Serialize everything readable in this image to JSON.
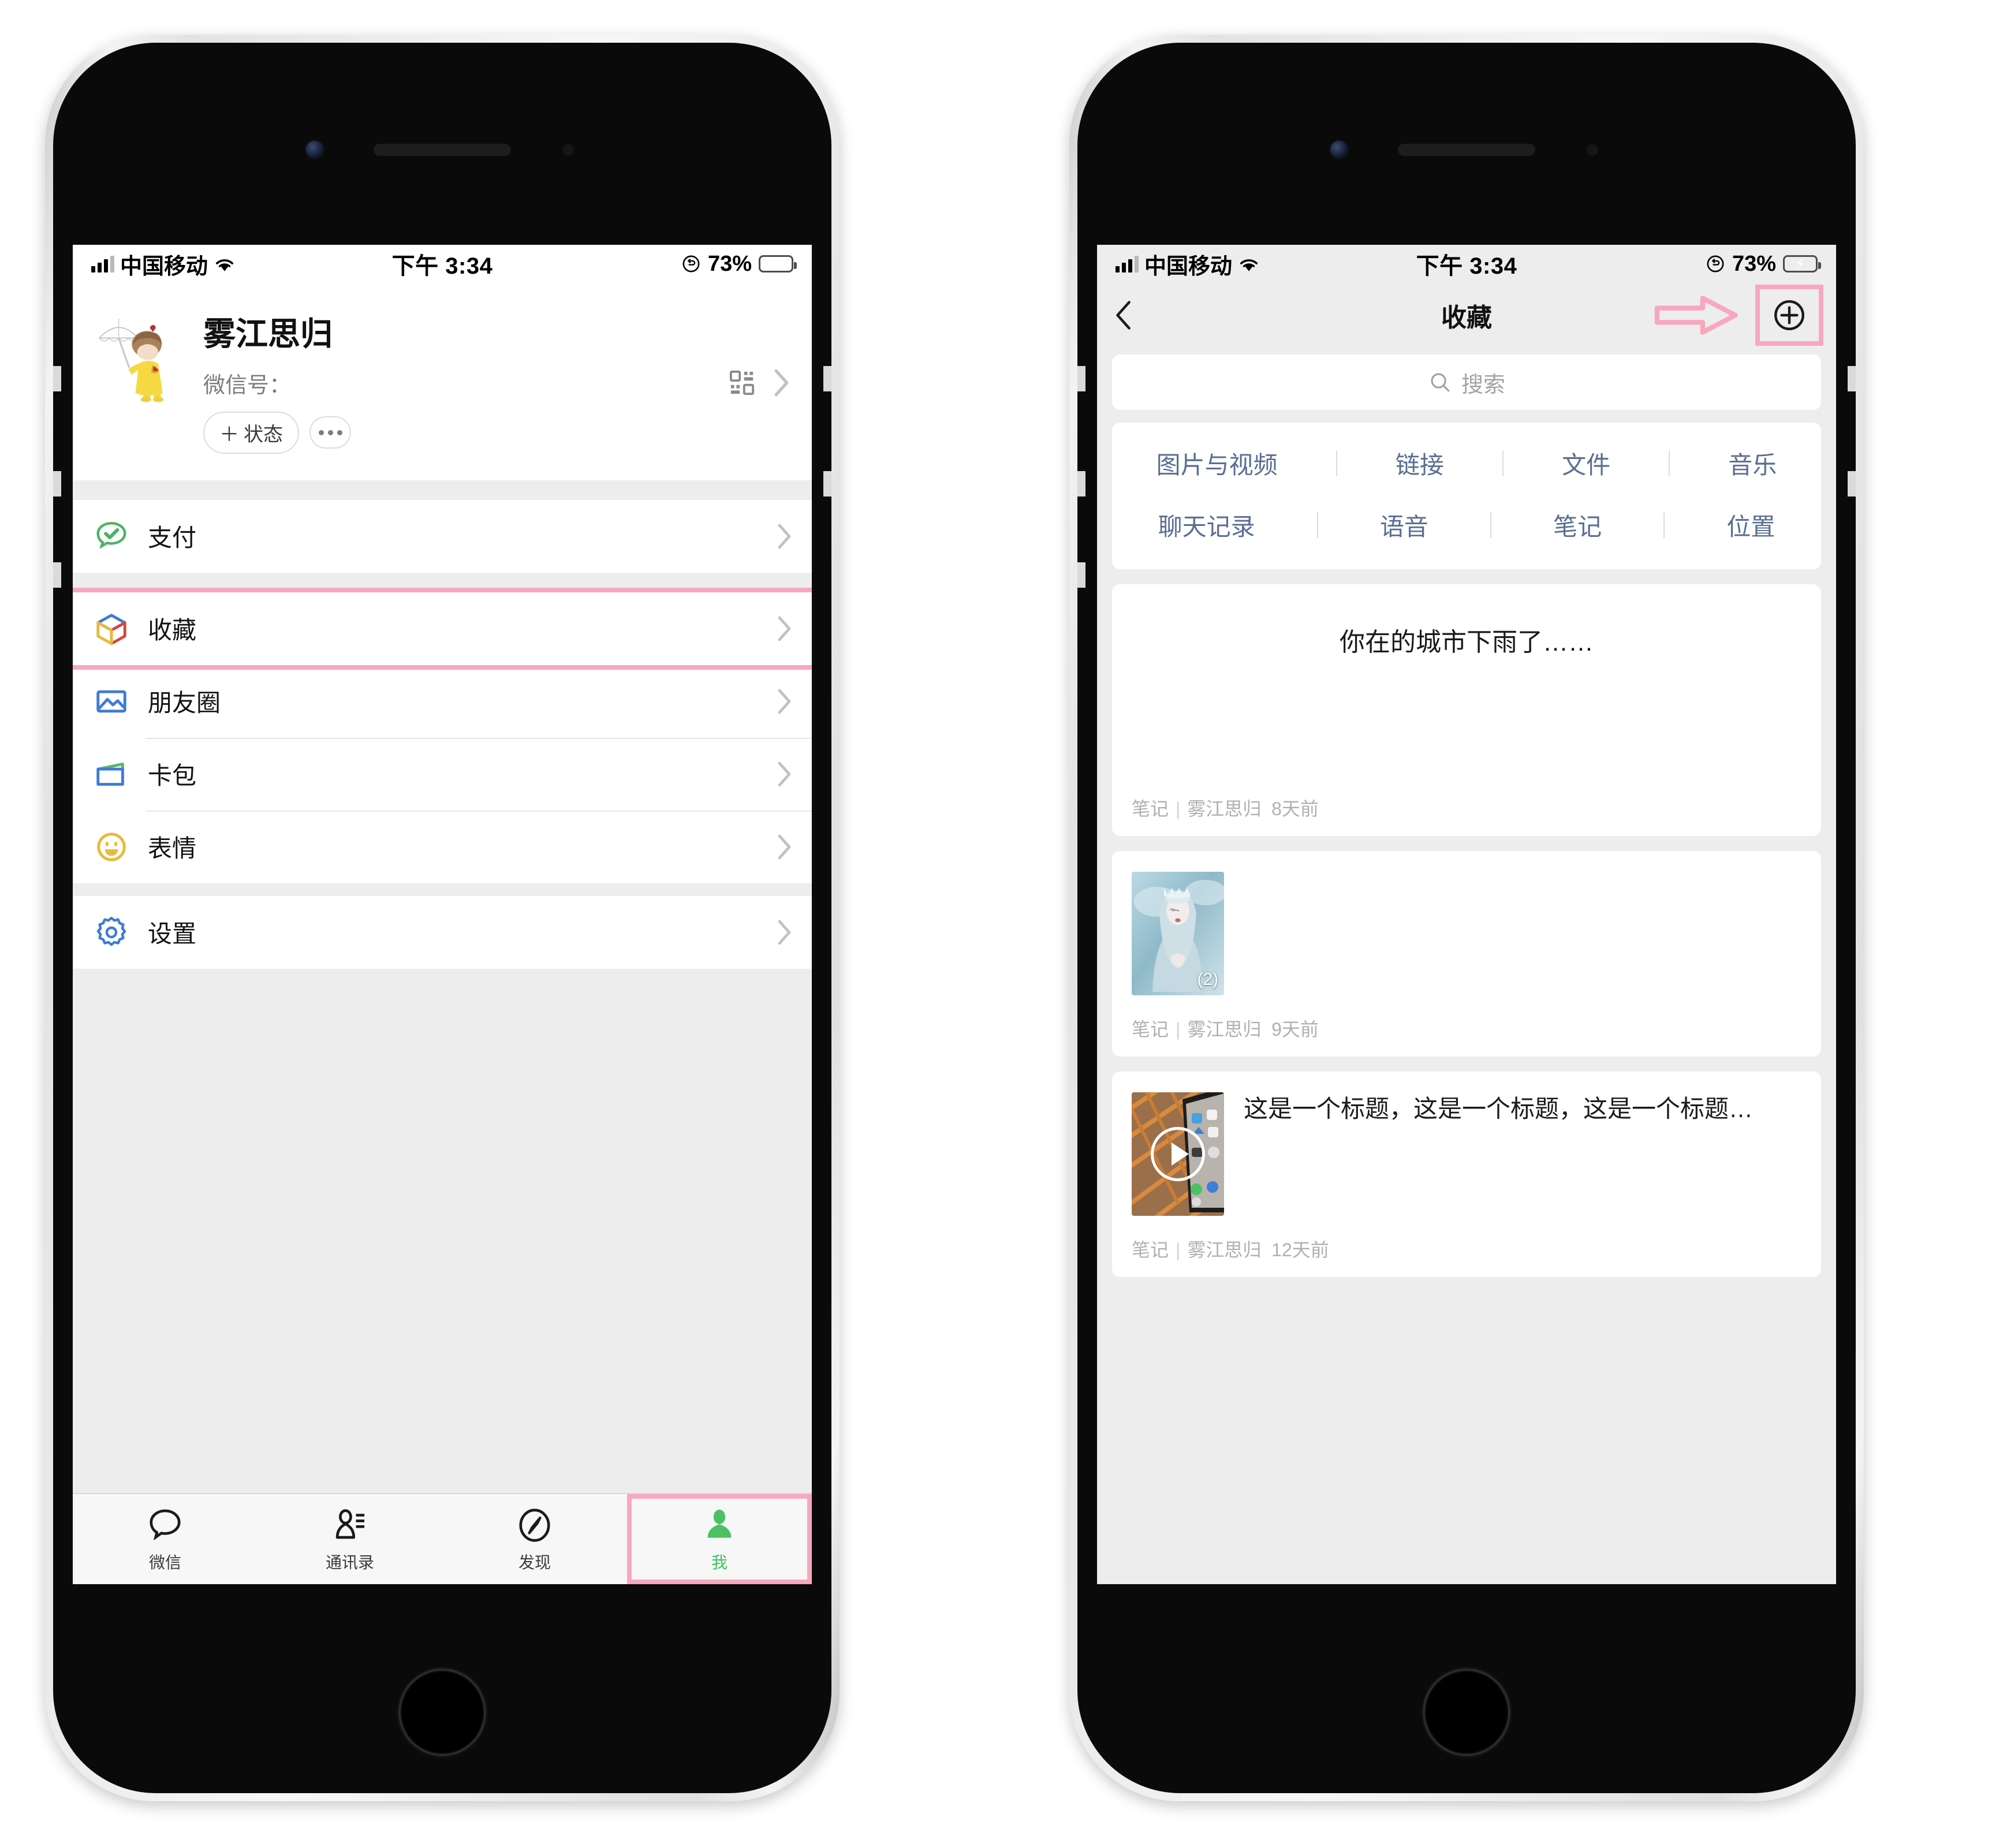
{
  "status_bar": {
    "carrier": "中国移动",
    "time": "下午 3:34",
    "battery_percent": "73%",
    "wifi_icon": "wifi-icon",
    "signal_icon": "signal-bars-icon",
    "rotation_lock_icon": "rotation-lock-icon",
    "battery_icon": "battery-charging-icon"
  },
  "left_phone": {
    "profile": {
      "avatar_icon": "avatar-girl-umbrella",
      "name": "雾江思归",
      "wechat_id_label": "微信号：",
      "qr_icon": "qr-code-icon",
      "chevron_icon": "chevron-right-icon",
      "status_button": "状态",
      "status_plus": "＋",
      "more_button_icon": "more-dots-icon"
    },
    "menu_groups": [
      {
        "items": [
          {
            "label": "支付",
            "icon": "pay-check-bubble-icon",
            "highlighted": false
          }
        ]
      },
      {
        "items": [
          {
            "label": "收藏",
            "icon": "favorites-cube-icon",
            "highlighted": true
          },
          {
            "label": "朋友圈",
            "icon": "moments-photo-icon",
            "highlighted": false
          },
          {
            "label": "卡包",
            "icon": "cards-wallet-icon",
            "highlighted": false
          },
          {
            "label": "表情",
            "icon": "stickers-smiley-icon",
            "highlighted": false
          }
        ]
      },
      {
        "items": [
          {
            "label": "设置",
            "icon": "settings-gear-icon",
            "highlighted": false
          }
        ]
      }
    ],
    "tabbar": [
      {
        "label": "微信",
        "icon": "chat-bubble-icon",
        "active": false,
        "highlighted": false
      },
      {
        "label": "通讯录",
        "icon": "contacts-icon",
        "active": false,
        "highlighted": false
      },
      {
        "label": "发现",
        "icon": "compass-icon",
        "active": false,
        "highlighted": false
      },
      {
        "label": "我",
        "icon": "person-icon",
        "active": true,
        "highlighted": true
      }
    ]
  },
  "right_phone": {
    "nav": {
      "back_icon": "chevron-left-icon",
      "title": "收藏",
      "add_icon": "circle-plus-icon",
      "add_highlighted": true,
      "annotation_arrow_icon": "pink-arrow-right-annotation"
    },
    "search": {
      "placeholder": "搜索",
      "icon": "search-icon"
    },
    "filters": [
      [
        "图片与视频",
        "链接",
        "文件",
        "音乐"
      ],
      [
        "聊天记录",
        "语音",
        "笔记",
        "位置"
      ]
    ],
    "items": [
      {
        "kind": "note",
        "title": "你在的城市下雨了……",
        "meta_type": "笔记",
        "meta_author": "雾江思归",
        "meta_time": "8天前"
      },
      {
        "kind": "image",
        "thumb_icon": "photo-thumbnail-blue-hair-girl",
        "count_badge": "(2)",
        "meta_type": "笔记",
        "meta_author": "雾江思归",
        "meta_time": "9天前"
      },
      {
        "kind": "video",
        "thumb_icon": "video-thumbnail-phone-on-grid",
        "play_icon": "play-circle-icon",
        "title": "这是一个标题，这是一个标题，这是一个标题…",
        "meta_type": "笔记",
        "meta_author": "雾江思归",
        "meta_time": "12天前"
      }
    ]
  },
  "colors": {
    "accent_pink": "#f7a8be",
    "wechat_green": "#3ec15f",
    "filter_blue": "#5a6e93",
    "screen_gray": "#ededed"
  }
}
